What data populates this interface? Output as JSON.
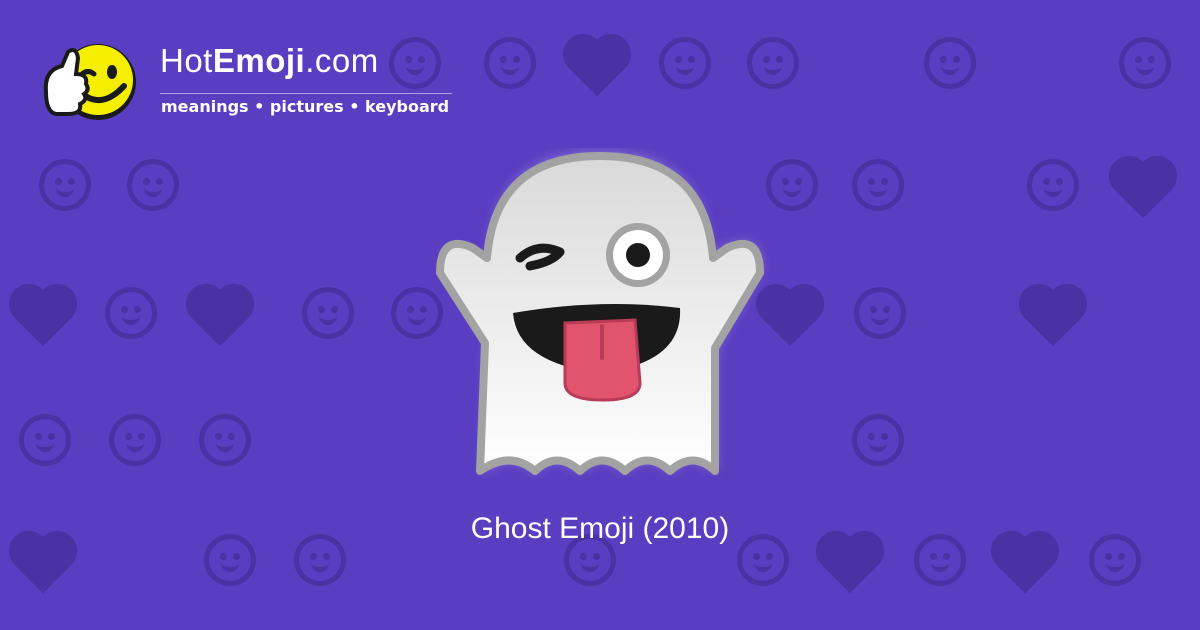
{
  "brand": {
    "name_regular": "Hot",
    "name_bold": "Emoji",
    "name_suffix": ".com",
    "tagline": "meanings • pictures • keyboard"
  },
  "hero": {
    "icon": "ghost-winking-tongue-icon",
    "caption": "Ghost Emoji (2010)"
  },
  "colors": {
    "background": "#5a3ec1",
    "pattern": "#4a31a4",
    "logo_face": "#f5ee00",
    "ghost_body": "#e9e9e9",
    "ghost_outline": "#a3a3a3",
    "tongue": "#e0546e"
  }
}
